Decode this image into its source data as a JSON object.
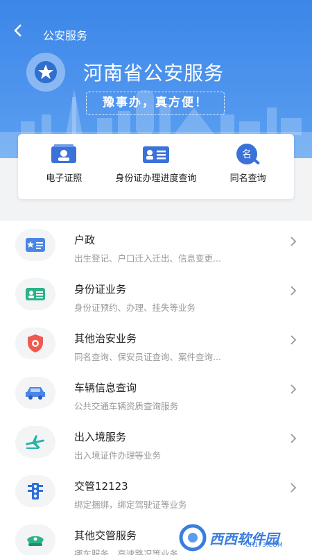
{
  "topbar": {
    "back_label": "<",
    "title": "公安服务"
  },
  "hero": {
    "title": "河南省公安服务",
    "slogan": "豫事办，真方便！"
  },
  "quick_actions": [
    {
      "label": "电子证照",
      "icon": "id-card-icon"
    },
    {
      "label": "身份证办理进度查询",
      "icon": "id-progress-icon"
    },
    {
      "label": "同名查询",
      "icon": "name-search-icon"
    }
  ],
  "services": [
    {
      "title": "户政",
      "subtitle": "出生登记、户口迁入迁出、信息变更...",
      "icon": "household-icon"
    },
    {
      "title": "身份证业务",
      "subtitle": "身份证预约、办理、挂失等业务",
      "icon": "id-card-icon"
    },
    {
      "title": "其他治安业务",
      "subtitle": "同名查询、保安员证查询、案件查询...",
      "icon": "shield-icon"
    },
    {
      "title": "车辆信息查询",
      "subtitle": "公共交通车辆资质查询服务",
      "icon": "car-icon"
    },
    {
      "title": "出入境服务",
      "subtitle": "出入境证件办理等业务",
      "icon": "airplane-icon"
    },
    {
      "title": "交管12123",
      "subtitle": "绑定捆绑，绑定驾驶证等业务",
      "icon": "traffic-light-icon"
    },
    {
      "title": "其他交管服务",
      "subtitle": "挪车服务、高速路况等业务",
      "icon": "police-cap-icon"
    }
  ],
  "watermark": {
    "text": "西西软件园",
    "sub": "CR173.COM"
  },
  "colors": {
    "primary": "#3b86e8",
    "accent": "#3a7de0",
    "list_bg": "#ffffff",
    "page_bg": "#f2f3f5"
  }
}
